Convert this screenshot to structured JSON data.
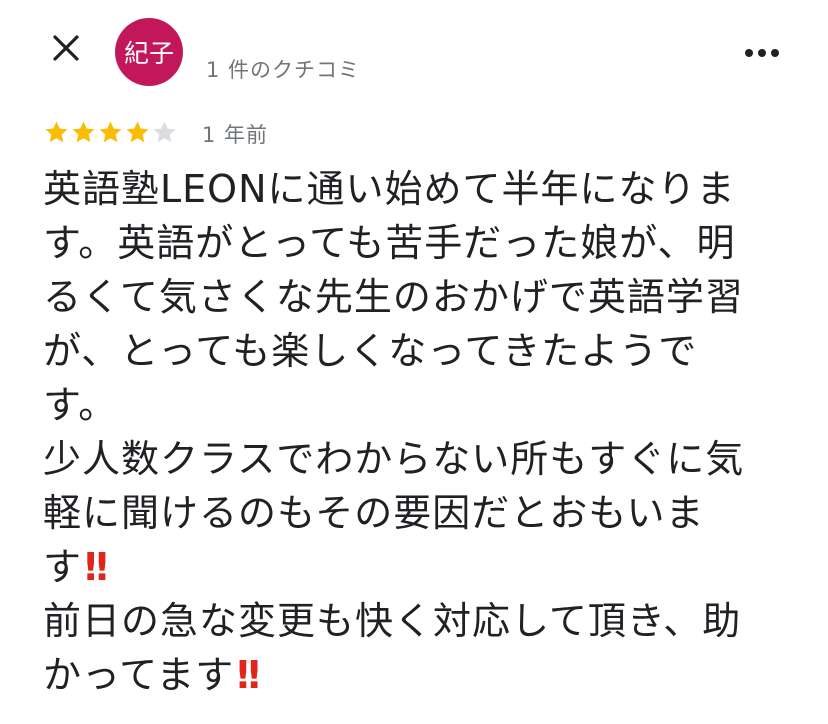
{
  "header": {
    "close_icon": "close-icon",
    "avatar_text": "紀子",
    "avatar_color": "#c2185b",
    "review_count": "1 件のクチコミ",
    "more_icon": "more-vert-icon"
  },
  "review": {
    "rating": 4,
    "max_rating": 5,
    "star_color": "#fbbc04",
    "empty_star_color": "#dadce0",
    "date": "1 年前",
    "lines": [
      {
        "text": "英語塾LEONに通い始めて半年になりま",
        "bang": ""
      },
      {
        "text": "す。英語がとっても苦手だった娘が、明",
        "bang": ""
      },
      {
        "text": "るくて気さくな先生のおかげで英語学習",
        "bang": ""
      },
      {
        "text": "が、とっても楽しくなってきたようで",
        "bang": ""
      },
      {
        "text": "す。",
        "bang": ""
      },
      {
        "text": "少人数クラスでわからない所もすぐに気",
        "bang": ""
      },
      {
        "text": "軽に聞けるのもその要因だとおもいま",
        "bang": ""
      },
      {
        "text": "す",
        "bang": "!!"
      },
      {
        "text": "前日の急な変更も快く対応して頂き、助",
        "bang": ""
      },
      {
        "text": "かってます",
        "bang": "!!"
      }
    ]
  }
}
